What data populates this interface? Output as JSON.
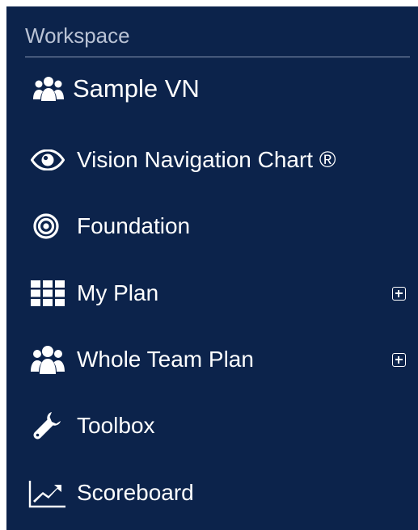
{
  "sidebar": {
    "section_title": "Workspace",
    "workspace_name": "Sample VN",
    "items": [
      {
        "label": "Vision Navigation Chart ®",
        "icon": "eye-icon",
        "expandable": false
      },
      {
        "label": "Foundation",
        "icon": "target-icon",
        "expandable": false
      },
      {
        "label": "My Plan",
        "icon": "grid-icon",
        "expandable": true
      },
      {
        "label": "Whole Team Plan",
        "icon": "users-icon",
        "expandable": true
      },
      {
        "label": "Toolbox",
        "icon": "wrench-icon",
        "expandable": false
      },
      {
        "label": "Scoreboard",
        "icon": "line-chart-icon",
        "expandable": false
      }
    ]
  },
  "colors": {
    "panel_background": "#0c234b",
    "header_text": "#b9c2d4",
    "item_text": "#ffffff"
  }
}
